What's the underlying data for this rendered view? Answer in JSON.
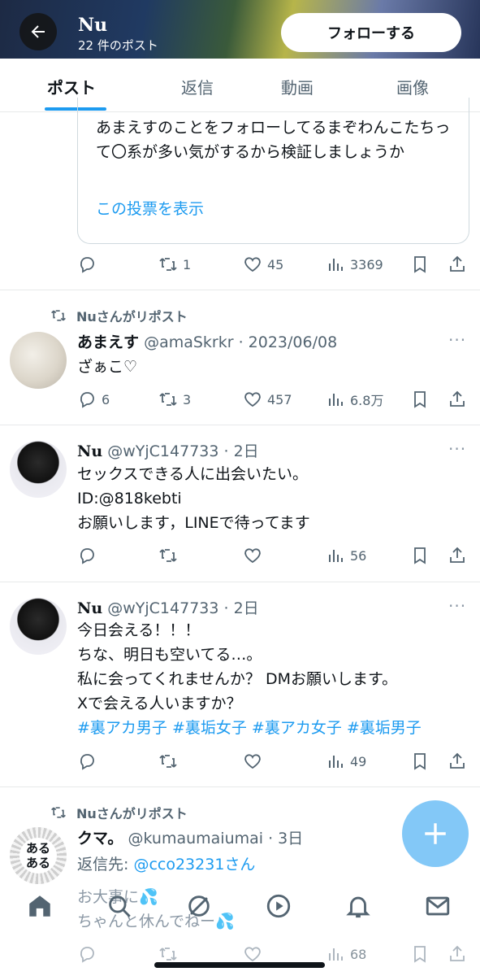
{
  "header": {
    "name": "Nu",
    "post_count": "22 件のポスト",
    "follow_label": "フォローする"
  },
  "tabs": [
    {
      "label": "ポスト",
      "active": true
    },
    {
      "label": "返信"
    },
    {
      "label": "動画"
    },
    {
      "label": "画像"
    }
  ],
  "quote": {
    "text": "あまえすのことをフォローしてるまぞわんこたちって〇系が多い気がするから検証しましょうか",
    "link": "この投票を表示"
  },
  "quote_actions": {
    "replies": "",
    "reposts": "1",
    "likes": "45",
    "views": "3369"
  },
  "tweets": [
    {
      "repost_by": "Nuさんがリポスト",
      "name": "あまえす",
      "handle_date": "@amaSkrkr · 2023/06/08",
      "lines": [
        "ざぁこ♡"
      ],
      "actions": {
        "replies": "6",
        "reposts": "3",
        "likes": "457",
        "views": "6.8万"
      }
    },
    {
      "name": "Nu",
      "handle_date": "@wYjC147733 · 2日",
      "lines": [
        "セックスできる人に出会いたい。",
        "ID:@818kebti",
        "お願いします，LINEで待ってます"
      ],
      "actions": {
        "replies": "",
        "reposts": "",
        "likes": "",
        "views": "56"
      }
    },
    {
      "name": "Nu",
      "handle_date": "@wYjC147733 · 2日",
      "lines": [
        "今日会える！！！",
        "ちな、明日も空いてる…。",
        "私に会ってくれませんか？ DMお願いします。",
        "Xで会える人いますか？"
      ],
      "hashtags": "#裏アカ男子 #裏垢女子 #裏アカ女子 #裏垢男子",
      "actions": {
        "replies": "",
        "reposts": "",
        "likes": "",
        "views": "49"
      }
    },
    {
      "repost_by": "Nuさんがリポスト",
      "name": "クマ。",
      "handle_date": "@kumaumaiumai · 3日",
      "reply_to_prefix": "返信先: ",
      "reply_to": "@cco23231さん",
      "lines": [
        "お大事に💦",
        "ちゃんと休んでねー💦"
      ],
      "avatar_text": "ある ある",
      "actions": {
        "replies": "",
        "reposts": "",
        "likes": "",
        "views": "68"
      }
    }
  ],
  "more_label": "···",
  "colors": {
    "accent": "#1d9bf0",
    "muted": "#536471",
    "text": "#0f1419"
  }
}
